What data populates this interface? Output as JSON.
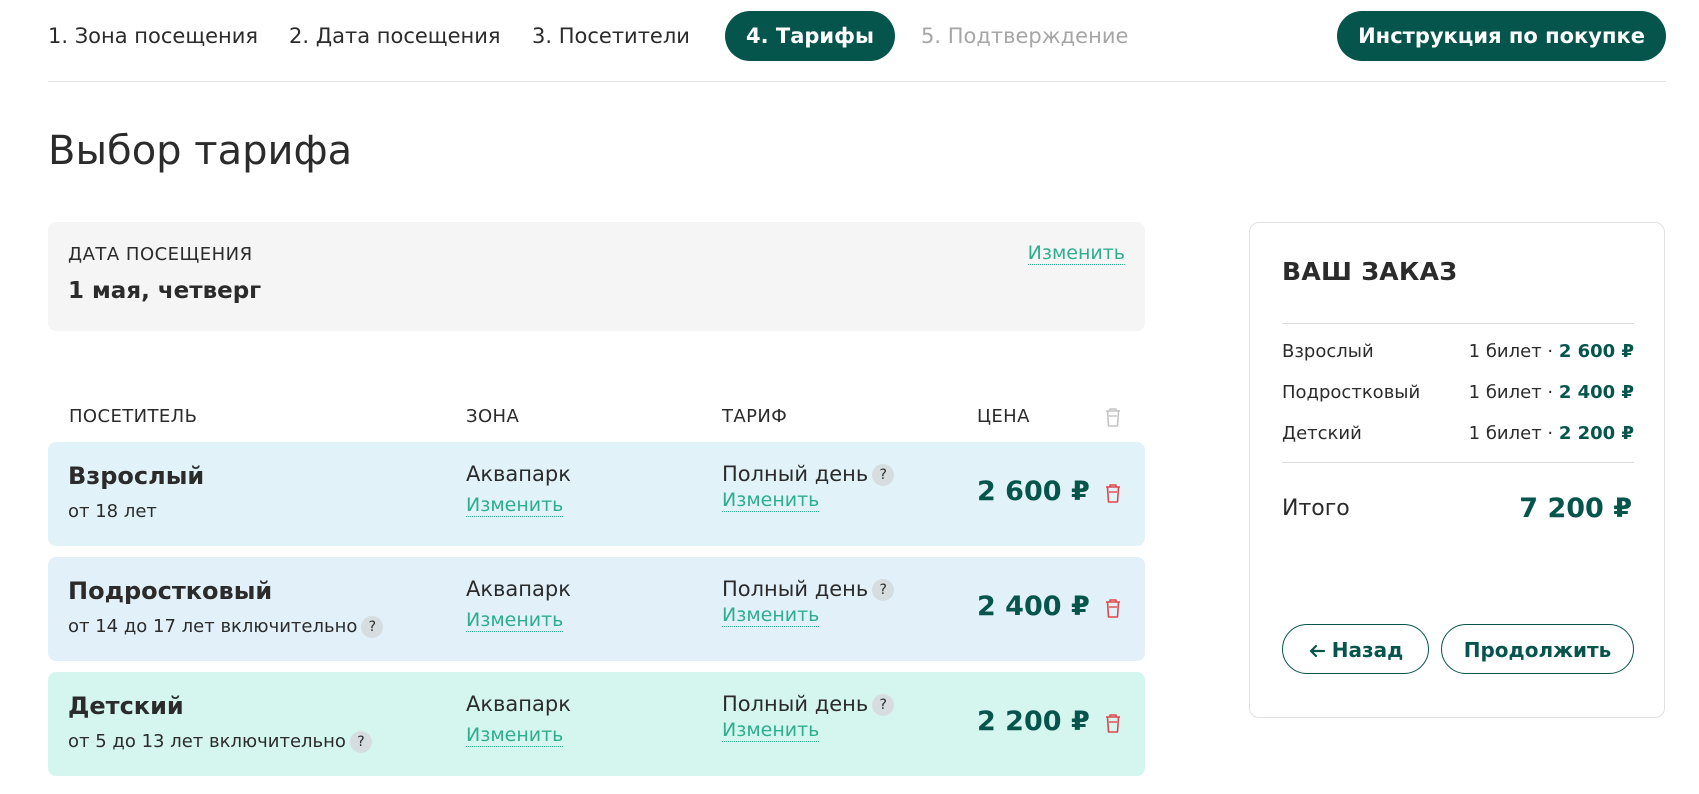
{
  "nav": {
    "steps": [
      {
        "label": "1. Зона посещения"
      },
      {
        "label": "2. Дата посещения"
      },
      {
        "label": "3. Посетители"
      },
      {
        "label": "4.  Тарифы"
      },
      {
        "label": "5. Подтверждение"
      }
    ],
    "guide_label": "Инструкция по покупке"
  },
  "page_title": "Выбор тарифа",
  "visit_date": {
    "label": "ДАТА ПОСЕЩЕНИЯ",
    "value": "1 мая, четверг",
    "change_label": "Изменить"
  },
  "table": {
    "headers": {
      "visitor": "ПОСЕТИТЕЛЬ",
      "zone": "ЗОНА",
      "tariff": "ТАРИФ",
      "price": "ЦЕНА"
    },
    "rows": [
      {
        "name": "Взрослый",
        "age": "от 18 лет",
        "zone": "Аквапарк",
        "zone_change": "Изменить",
        "tariff": "Полный день",
        "tariff_change": "Изменить",
        "price": "2 600 ₽",
        "bg": "#e1f3f9"
      },
      {
        "name": "Подростковый",
        "age": "от 14 до 17 лет включительно",
        "zone": "Аквапарк",
        "zone_change": "Изменить",
        "tariff": "Полный день",
        "tariff_change": "Изменить",
        "price": "2 400 ₽",
        "bg": "#e2f1f9"
      },
      {
        "name": "Детский",
        "age": "от 5 до 13 лет включительно",
        "zone": "Аквапарк",
        "zone_change": "Изменить",
        "tariff": "Полный день",
        "tariff_change": "Изменить",
        "price": "2 200 ₽",
        "bg": "#d5f6ef"
      }
    ]
  },
  "order": {
    "title": "ВАШ ЗАКАЗ",
    "items": [
      {
        "name": "Взрослый",
        "qty": "1 билет · ",
        "price": "2 600 ₽"
      },
      {
        "name": "Подростковый",
        "qty": "1 билет · ",
        "price": "2 400 ₽"
      },
      {
        "name": "Детский",
        "qty": "1 билет · ",
        "price": "2 200 ₽"
      }
    ],
    "total_label": "Итого",
    "total_value": "7 200 ₽",
    "back_label": "Назад",
    "continue_label": "Продолжить"
  },
  "help_glyph": "?",
  "icons": {
    "trash": "trash-icon",
    "back_arrow": "arrow-left-icon",
    "help": "question-icon"
  },
  "colors": {
    "brand": "#06554d",
    "link": "#2fae8f",
    "danger": "#e0474c",
    "muted": "#a6a6a6"
  }
}
